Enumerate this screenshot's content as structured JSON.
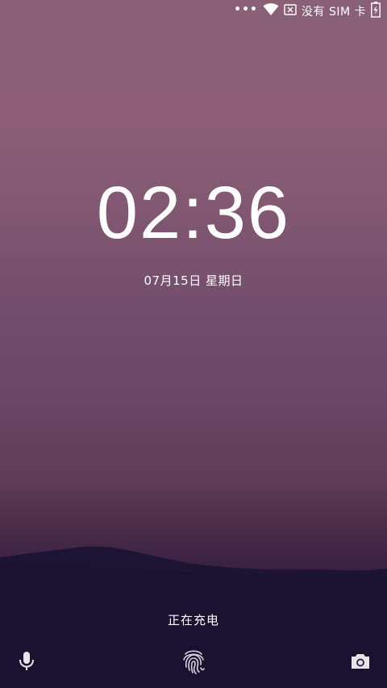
{
  "status_bar": {
    "dots": "•••",
    "sim_status": "没有 SIM 卡",
    "icons": [
      "wifi-icon",
      "sim-x-icon",
      "battery-charging-icon"
    ]
  },
  "lock_screen": {
    "time": "02:36",
    "date": "07月15日 星期日",
    "charging_text": "正在充电"
  },
  "shortcuts": {
    "left": "microphone-icon",
    "center": "fingerprint-icon",
    "right": "camera-icon"
  },
  "colors": {
    "sky_top": "#8a6076",
    "sky_mid": "#6e4a6a",
    "horizon": "#4d2d48",
    "mountain": "#1b1230"
  }
}
